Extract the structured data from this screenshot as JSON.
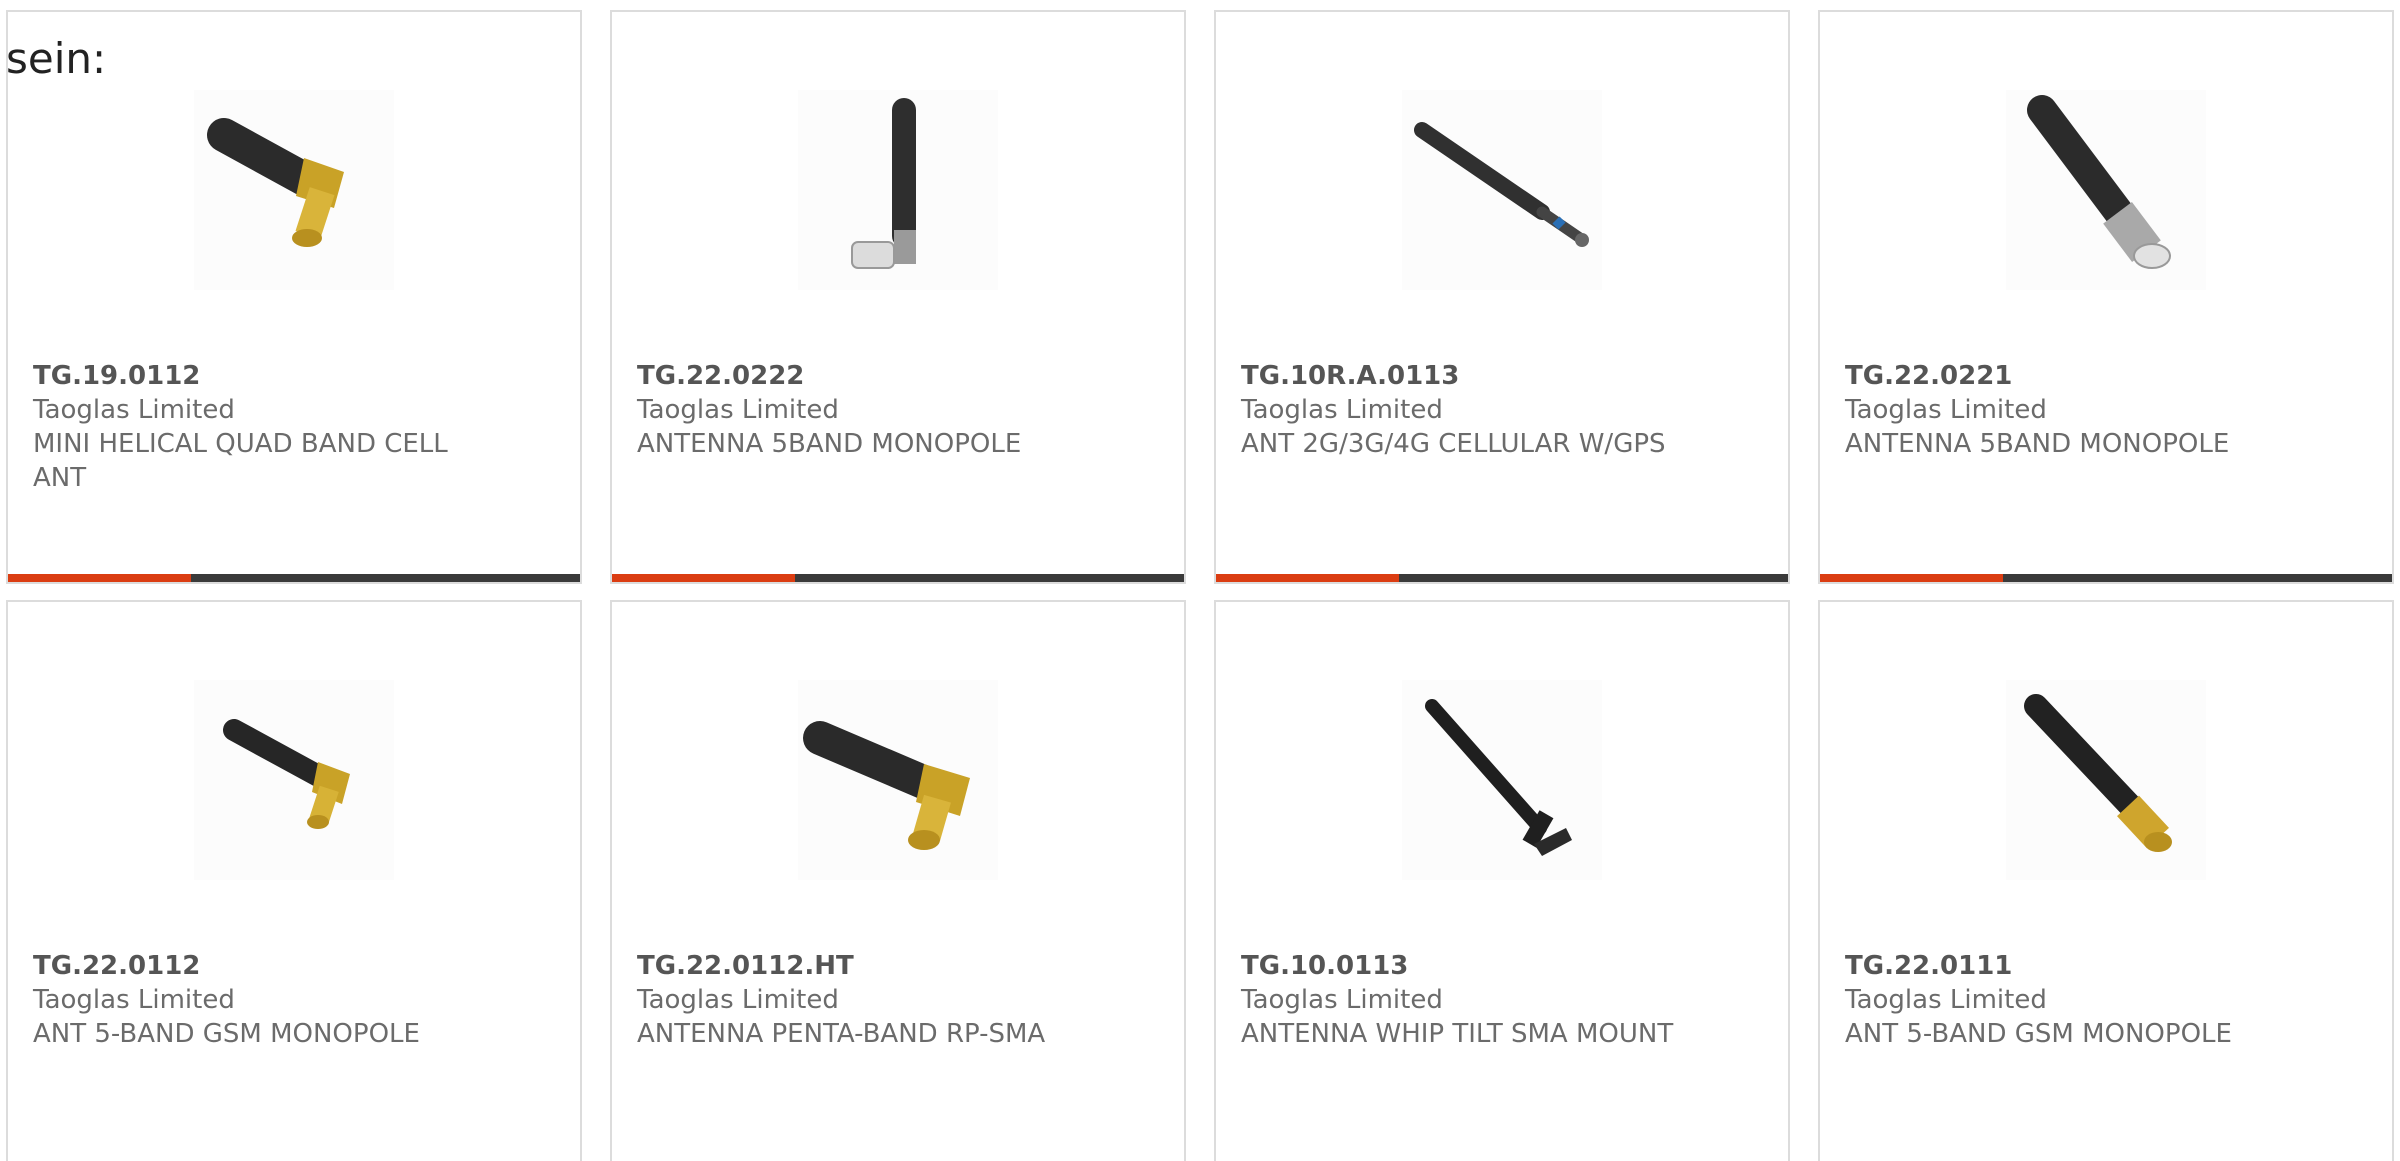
{
  "intro_text": "sein:",
  "colors": {
    "accent": "#db3d12",
    "bar": "#3a3a3a",
    "border": "#dcdcdc",
    "text": "#6b6b6b"
  },
  "products": [
    {
      "part": "TG.19.0112",
      "maker": "Taoglas Limited",
      "desc": "MINI HELICAL QUAD BAND CELL ANT",
      "icon": "angled-sma-antenna-icon",
      "progress": 0.32
    },
    {
      "part": "TG.22.0222",
      "maker": "Taoglas Limited",
      "desc": "ANTENNA 5BAND MONOPOLE",
      "icon": "vertical-fme-antenna-icon",
      "progress": 0.32
    },
    {
      "part": "TG.10R.A.0113",
      "maker": "Taoglas Limited",
      "desc": "ANT 2G/3G/4G CELLULAR W/GPS",
      "icon": "slim-cellular-antenna-icon",
      "progress": 0.32
    },
    {
      "part": "TG.22.0221",
      "maker": "Taoglas Limited",
      "desc": "ANTENNA 5BAND MONOPOLE",
      "icon": "straight-fme-antenna-icon",
      "progress": 0.32
    },
    {
      "part": "TG.22.0112",
      "maker": "Taoglas Limited",
      "desc": "ANT 5-BAND GSM MONOPOLE",
      "icon": "angled-sma-antenna-icon"
    },
    {
      "part": "TG.22.0112.HT",
      "maker": "Taoglas Limited",
      "desc": "ANTENNA PENTA-BAND RP-SMA",
      "icon": "angled-rp-sma-antenna-icon"
    },
    {
      "part": "TG.10.0113",
      "maker": "Taoglas Limited",
      "desc": "ANTENNA WHIP TILT SMA MOUNT",
      "icon": "tilt-whip-antenna-icon"
    },
    {
      "part": "TG.22.0111",
      "maker": "Taoglas Limited",
      "desc": "ANT 5-BAND GSM MONOPOLE",
      "icon": "straight-sma-antenna-icon"
    }
  ]
}
